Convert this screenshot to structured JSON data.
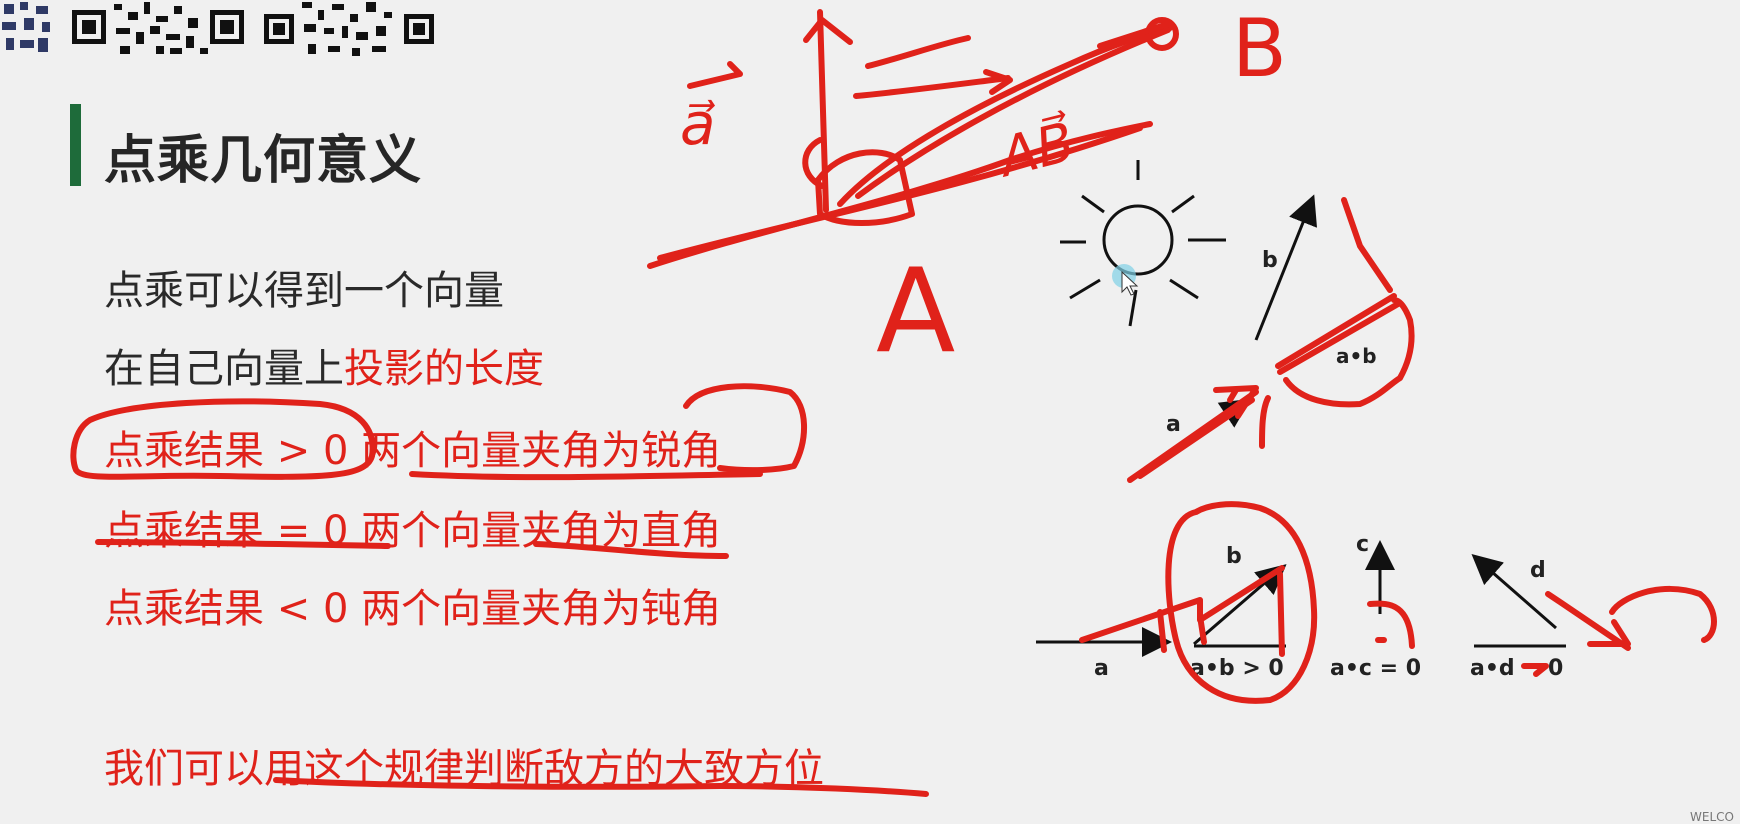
{
  "slide": {
    "title": "点乘几何意义",
    "lines": [
      {
        "text": "点乘可以得到一个向量"
      },
      {
        "before": "在自己向量上",
        "highlight": "投影的长度"
      },
      {
        "text": "点乘结果 > 0 两个向量夹角为锐角"
      },
      {
        "text": "点乘结果 = 0 两个向量夹角为直角"
      },
      {
        "text": "点乘结果 < 0 两个向量夹角为钝角"
      }
    ],
    "bottom_line": "我们可以用这个规律判断敌方的大致方位"
  },
  "diagram": {
    "projection": {
      "label_b": "b",
      "label_ab": "a•b",
      "label_a": "a"
    },
    "cases": {
      "a_label": "a",
      "b_label": "b",
      "c_label": "c",
      "d_label": "d",
      "ab_text": "a•b > 0",
      "ac_text": "a•c = 0",
      "ad_text": "a•d",
      "ad_zero": "0"
    }
  },
  "annotations": {
    "a_vec": "a⃗",
    "ab_vec": "AB⃗",
    "point_A": "A",
    "point_B": "B"
  },
  "footer": {
    "corner": "WELCO"
  },
  "colors": {
    "accent": "#1e6b3a",
    "ink": "#e0221a",
    "text": "#2a2a2a"
  }
}
